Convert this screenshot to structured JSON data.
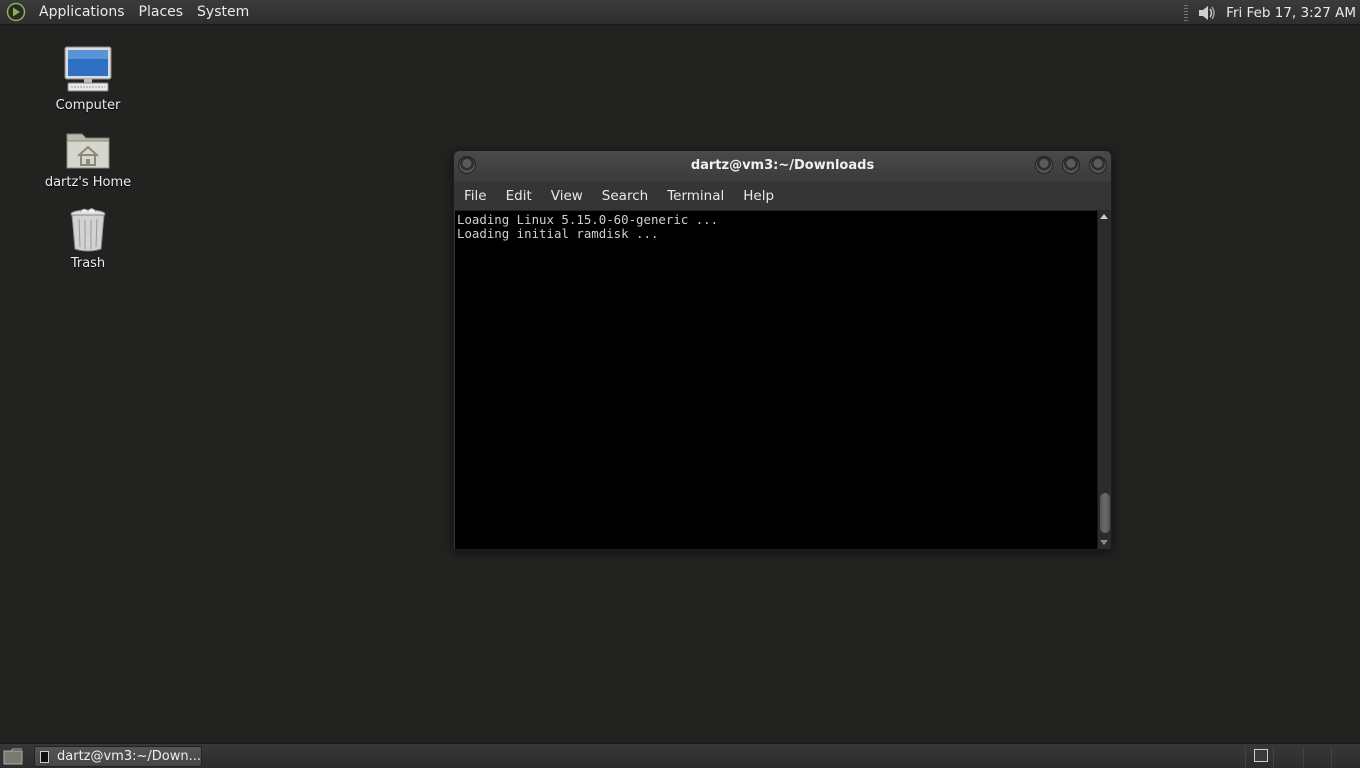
{
  "top_panel": {
    "menus": [
      "Applications",
      "Places",
      "System"
    ],
    "clock": "Fri Feb 17,  3:27 AM",
    "logo_icon": "gnome-menu-icon",
    "volume_icon": "speaker-icon"
  },
  "desktop": {
    "icons": [
      {
        "label": "Computer",
        "icon": "computer-icon"
      },
      {
        "label": "dartz's Home",
        "icon": "home-folder-icon"
      },
      {
        "label": "Trash",
        "icon": "trash-icon"
      }
    ]
  },
  "window": {
    "title": "dartz@vm3:~/Downloads",
    "menus": [
      "File",
      "Edit",
      "View",
      "Search",
      "Terminal",
      "Help"
    ],
    "terminal_lines": [
      "Loading Linux 5.15.0-60-generic ...",
      "Loading initial ramdisk ..."
    ]
  },
  "bottom_panel": {
    "task_label": "dartz@vm3:~/Down..."
  },
  "colors": {
    "desktop_bg": "#222321",
    "panel_bg": "#333333",
    "terminal_bg": "#000000",
    "terminal_fg": "#cfcfcf"
  }
}
